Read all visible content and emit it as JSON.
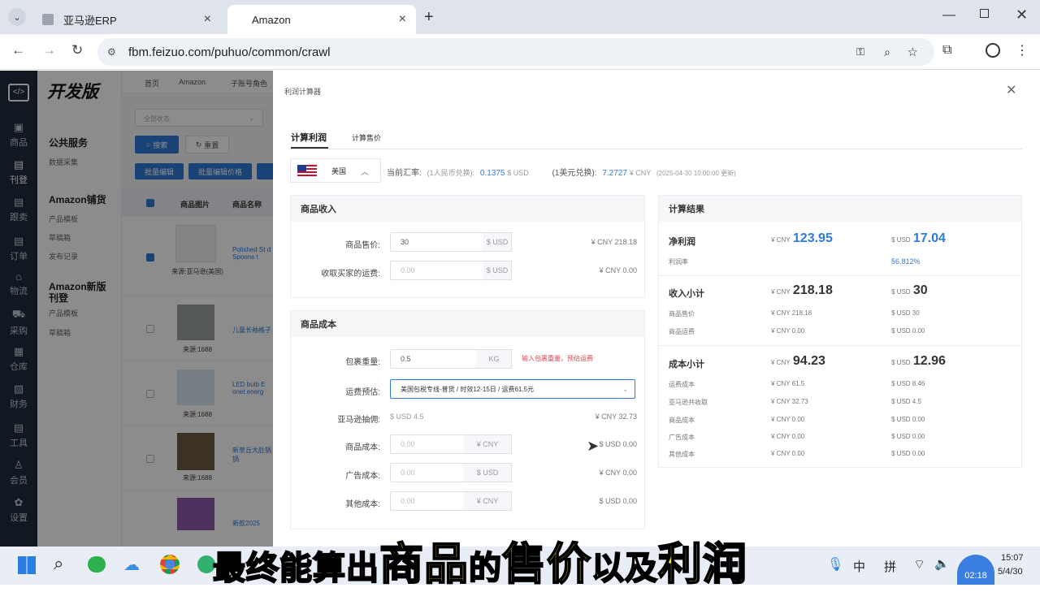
{
  "browser": {
    "tabs": [
      {
        "label": "亚马逊ERP"
      },
      {
        "label": "Amazon"
      }
    ],
    "url": "fbm.feizuo.com/puhuo/common/crawl"
  },
  "sidebar": {
    "items": [
      {
        "label": "商品"
      },
      {
        "label": "刊登"
      },
      {
        "label": "跟卖"
      },
      {
        "label": "订单"
      },
      {
        "label": "物流"
      },
      {
        "label": "采购"
      },
      {
        "label": "仓库"
      },
      {
        "label": "财务"
      },
      {
        "label": "工具"
      },
      {
        "label": "会员"
      },
      {
        "label": "设置"
      }
    ]
  },
  "subnav": {
    "logo": "开发版",
    "groups": [
      {
        "title": "公共服务",
        "items": [
          "数据采集"
        ]
      },
      {
        "title": "Amazon铺货",
        "items": [
          "产品模板",
          "草稿箱",
          "发布记录"
        ]
      },
      {
        "title": "Amazon新版刊登",
        "items": [
          "产品模板",
          "草稿箱"
        ]
      }
    ]
  },
  "background_page": {
    "tabs": [
      "首页",
      "Amazon",
      "子账号角色"
    ],
    "status_select": "全部状态",
    "search_btn": "搜索",
    "reset_btn": "重置",
    "batch_edit": "批量编辑",
    "batch_price": "批量编辑价格",
    "col_img": "商品图片",
    "col_name": "商品名称",
    "rows": [
      {
        "source": "来源:亚马逊(美国)",
        "name": "Polished St d Spoons t"
      },
      {
        "source": "来源:1688",
        "name": "儿童长袖格子"
      },
      {
        "source": "来源:1688",
        "name": "LED bulb E onet energ"
      },
      {
        "source": "来源:1688",
        "name": "新草丘大肚锅 锅"
      },
      {
        "source": "",
        "name": "新款2025"
      }
    ]
  },
  "drawer": {
    "title": "利润计算器",
    "tabs": [
      "计算利润",
      "计算售价"
    ],
    "country": "美国",
    "rate_label": "当前汇率:",
    "rate_cny_note": "(1人民币兑换):",
    "rate_cny_value": "0.1375",
    "rate_cny_unit": "$ USD",
    "rate_usd_note": "(1美元兑换):",
    "rate_usd_value": "7.2727",
    "rate_usd_unit": "¥ CNY",
    "rate_time": "(2025-04-30 10:00:00 更新)",
    "income": {
      "title": "商品收入",
      "price_label": "商品售价:",
      "price_value": "30",
      "price_unit": "$ USD",
      "price_cny": "¥ CNY 218.18",
      "ship_label": "收取买家的运费:",
      "ship_placeholder": "0.00",
      "ship_unit": "$ USD",
      "ship_cny": "¥ CNY 0.00"
    },
    "cost": {
      "title": "商品成本",
      "weight_label": "包裹重量:",
      "weight_value": "0.5",
      "weight_unit": "KG",
      "weight_hint": "输入包裹重量，预估运费",
      "ship_est_label": "运费预估:",
      "ship_est_value": "美国包税专线-普货 / 时效12-15日 / 运费61.5元",
      "commission_label": "亚马逊抽佣:",
      "commission_usd": "$ USD 4.5",
      "commission_cny": "¥ CNY 32.73",
      "goods_label": "商品成本:",
      "goods_placeholder": "0.00",
      "goods_unit": "¥ CNY",
      "goods_conv": "$ USD 0.00",
      "ad_label": "广告成本:",
      "ad_placeholder": "0.00",
      "ad_unit": "$ USD",
      "ad_conv": "¥ CNY 0.00",
      "other_label": "其他成本:",
      "other_placeholder": "0.00",
      "other_unit": "¥ CNY",
      "other_conv": "$ USD 0.00"
    },
    "result": {
      "title": "计算结果",
      "profit_label": "净利润",
      "profit_cny_prefix": "¥ CNY",
      "profit_cny": "123.95",
      "profit_usd_prefix": "$ USD",
      "profit_usd": "17.04",
      "margin_label": "利润率",
      "margin_value": "56.812%",
      "income_label": "收入小计",
      "income_cny_prefix": "¥ CNY",
      "income_cny": "218.18",
      "income_usd_prefix": "$ USD",
      "income_usd": "30",
      "income_rows": [
        {
          "label": "商品售价",
          "cny": "¥ CNY 218.18",
          "usd": "$ USD 30"
        },
        {
          "label": "商品运费",
          "cny": "¥ CNY 0.00",
          "usd": "$ USD 0.00"
        }
      ],
      "cost_label": "成本小计",
      "cost_cny_prefix": "¥ CNY",
      "cost_cny": "94.23",
      "cost_usd_prefix": "$ USD",
      "cost_usd": "12.96",
      "cost_rows": [
        {
          "label": "运费成本",
          "cny": "¥ CNY 61.5",
          "usd": "$ USD 8.46"
        },
        {
          "label": "亚马逊共收取",
          "cny": "¥ CNY 32.73",
          "usd": "$ USD 4.5"
        },
        {
          "label": "商品成本",
          "cny": "¥ CNY 0.00",
          "usd": "$ USD 0.00"
        },
        {
          "label": "广告成本",
          "cny": "¥ CNY 0.00",
          "usd": "$ USD 0.00"
        },
        {
          "label": "其他成本",
          "cny": "¥ CNY 0.00",
          "usd": "$ USD 0.00"
        }
      ]
    }
  },
  "subtitle": {
    "p1": "最终能算出",
    "p2": "商品",
    "p3": "的",
    "p4": "售价",
    "p5": "以及",
    "p6": "利润"
  },
  "taskbar": {
    "ime1": "中",
    "ime2": "拼",
    "time": "15:07",
    "date": "5/4/30",
    "badge": "02:18"
  },
  "colors": {
    "accent": "#2f7bd8",
    "sidebar": "#1f2d3d",
    "warning": "#e0434b"
  }
}
